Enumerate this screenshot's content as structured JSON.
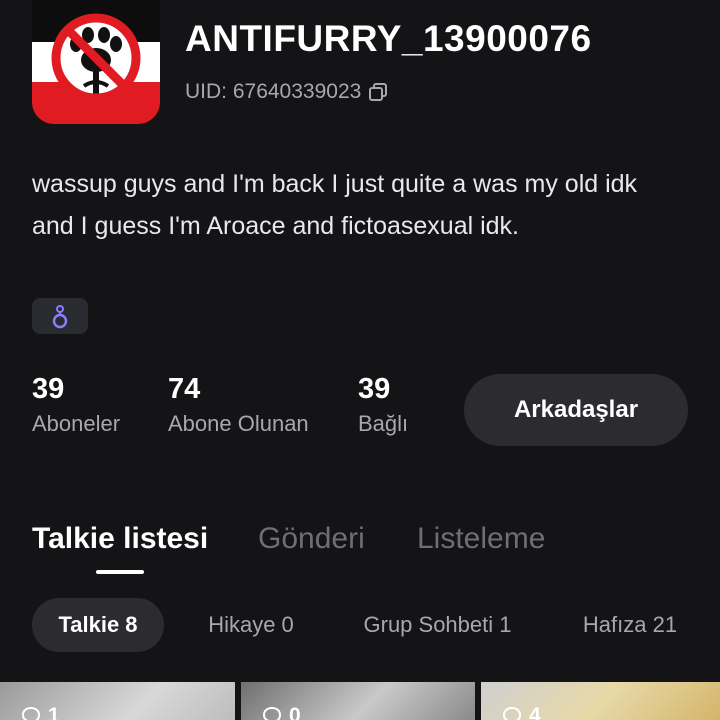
{
  "profile": {
    "username": "ANTIFURRY_13900076",
    "uid": "UID: 67640339023",
    "bio": "wassup guys and I'm back I just quite a was my old idk and I guess I'm Aroace and fictoasexual idk."
  },
  "stats": [
    {
      "value": "39",
      "label": "Aboneler"
    },
    {
      "value": "74",
      "label": "Abone Olunan"
    },
    {
      "value": "39",
      "label": "Bağlı"
    }
  ],
  "friends_button": "Arkadaşlar",
  "tabs": [
    {
      "label": "Talkie listesi",
      "active": true
    },
    {
      "label": "Gönderi",
      "active": false
    },
    {
      "label": "Listeleme",
      "active": false
    }
  ],
  "chips": [
    {
      "label": "Talkie 8",
      "active": true
    },
    {
      "label": "Hikaye 0",
      "active": false
    },
    {
      "label": "Grup Sohbeti 1",
      "active": false
    },
    {
      "label": "Hafıza 21",
      "active": false
    }
  ],
  "cards": [
    {
      "count": "1"
    },
    {
      "count": "0"
    },
    {
      "count": "4"
    }
  ],
  "colors": {
    "background": "#141416",
    "button_bg": "#2b2b30",
    "badge_bg": "#2a2a31",
    "badge_icon": "#8e7cff",
    "prohibition_red": "#e11b22"
  },
  "icons": {
    "copy": "copy-icon",
    "badge": "ring-badge-icon",
    "card_count": "chat-bubble-icon"
  }
}
